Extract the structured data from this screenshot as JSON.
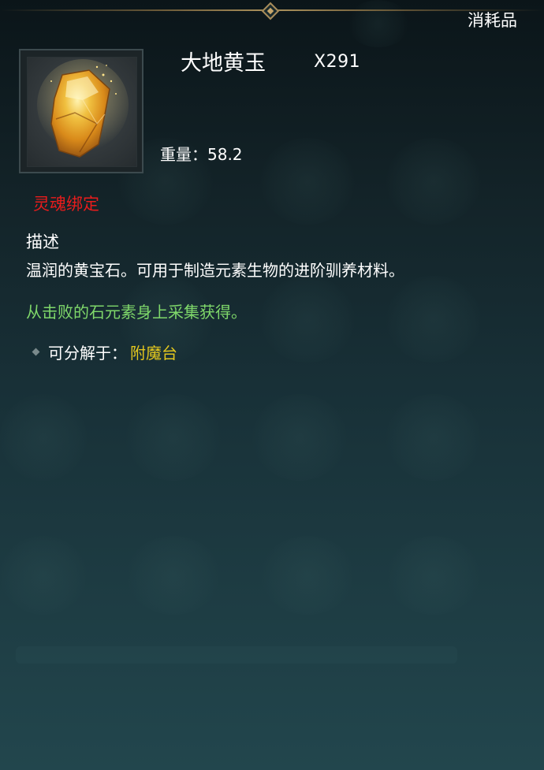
{
  "item": {
    "category": "消耗品",
    "name": "大地黄玉",
    "quantity": "X291",
    "icon": "amber-gem-icon",
    "weight_label": "重量",
    "weight_value": "58.2",
    "bind_status": "灵魂绑定",
    "description_title": "描述",
    "description": "温润的黄宝石。可用于制造元素生物的进阶驯养材料。",
    "source": "从击败的石元素身上采集获得。",
    "disassemble_label": "可分解于：",
    "disassemble_target": "附魔台"
  },
  "colors": {
    "bind": "#e81c1c",
    "source": "#7fd86a",
    "disassemble_target": "#e3c71e",
    "frame_accent": "#a88c5a"
  }
}
